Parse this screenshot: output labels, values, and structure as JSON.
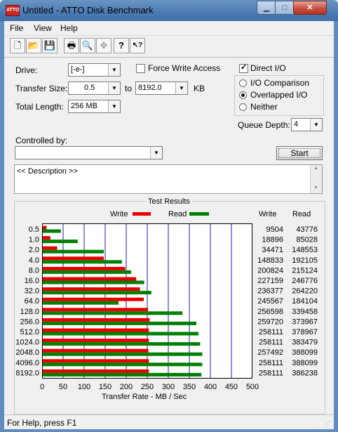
{
  "window": {
    "title": "Untitled - ATTO Disk Benchmark",
    "icon_text": "ATTO"
  },
  "menu": [
    {
      "label": "File"
    },
    {
      "label": "View"
    },
    {
      "label": "Help"
    }
  ],
  "toolbar": [
    {
      "name": "new-file-icon",
      "glyph": "🗋"
    },
    {
      "name": "open-folder-icon",
      "glyph": "📂"
    },
    {
      "name": "save-icon",
      "glyph": "💾"
    },
    {
      "name": "print-icon",
      "glyph": "🖶"
    },
    {
      "name": "print-preview-icon",
      "glyph": "🔍"
    },
    {
      "name": "move-icon",
      "glyph": "✥"
    },
    {
      "name": "help-icon",
      "glyph": "?"
    },
    {
      "name": "context-help-icon",
      "glyph": "↖?"
    }
  ],
  "form": {
    "drive_label": "Drive:",
    "drive_value": "[-e-]",
    "force_write_label": "Force Write Access",
    "transfer_size_label": "Transfer Size:",
    "transfer_from": "0.5",
    "to_label": "to",
    "transfer_to": "8192.0",
    "kb_label": "KB",
    "total_length_label": "Total Length:",
    "total_length_value": "256 MB",
    "direct_io_label": "Direct I/O",
    "io_comparison_label": "I/O Comparison",
    "overlapped_io_label": "Overlapped I/O",
    "neither_label": "Neither",
    "queue_depth_label": "Queue Depth:",
    "queue_depth_value": "4",
    "controlled_by_label": "Controlled by:",
    "controlled_by_value": "",
    "start_label": "Start",
    "description": "<< Description >>"
  },
  "colors": {
    "write": "#e80000",
    "read": "#008000",
    "gridline": "#1c1cb0"
  },
  "chart_data": {
    "type": "bar",
    "orientation": "horizontal",
    "title": "Test Results",
    "xlabel": "Transfer Rate - MB / Sec",
    "xlim": [
      0,
      500
    ],
    "xticks": [
      0,
      50,
      100,
      150,
      200,
      250,
      300,
      350,
      400,
      450,
      500
    ],
    "categories": [
      "0.5",
      "1.0",
      "2.0",
      "4.0",
      "8.0",
      "16.0",
      "32.0",
      "64.0",
      "128.0",
      "256.0",
      "512.0",
      "1024.0",
      "2048.0",
      "4096.0",
      "8192.0"
    ],
    "series": [
      {
        "name": "Write",
        "values": [
          9,
          18,
          34,
          145,
          196,
          222,
          231,
          240,
          250,
          254,
          252,
          252,
          251,
          252,
          252
        ],
        "raw": [
          "9504",
          "18896",
          "34471",
          "148833",
          "200824",
          "227159",
          "236377",
          "245567",
          "256598",
          "259720",
          "258111",
          "258111",
          "257492",
          "258111",
          "258111"
        ]
      },
      {
        "name": "Read",
        "values": [
          43,
          83,
          145,
          188,
          210,
          241,
          258,
          180,
          332,
          365,
          370,
          374,
          379,
          379,
          377
        ],
        "raw": [
          "43776",
          "85028",
          "148553",
          "192105",
          "215124",
          "246776",
          "264220",
          "184104",
          "339458",
          "373967",
          "378967",
          "383479",
          "388099",
          "388099",
          "386238"
        ]
      }
    ],
    "legend": "top",
    "grid": "vertical"
  },
  "status": "For Help, press F1"
}
